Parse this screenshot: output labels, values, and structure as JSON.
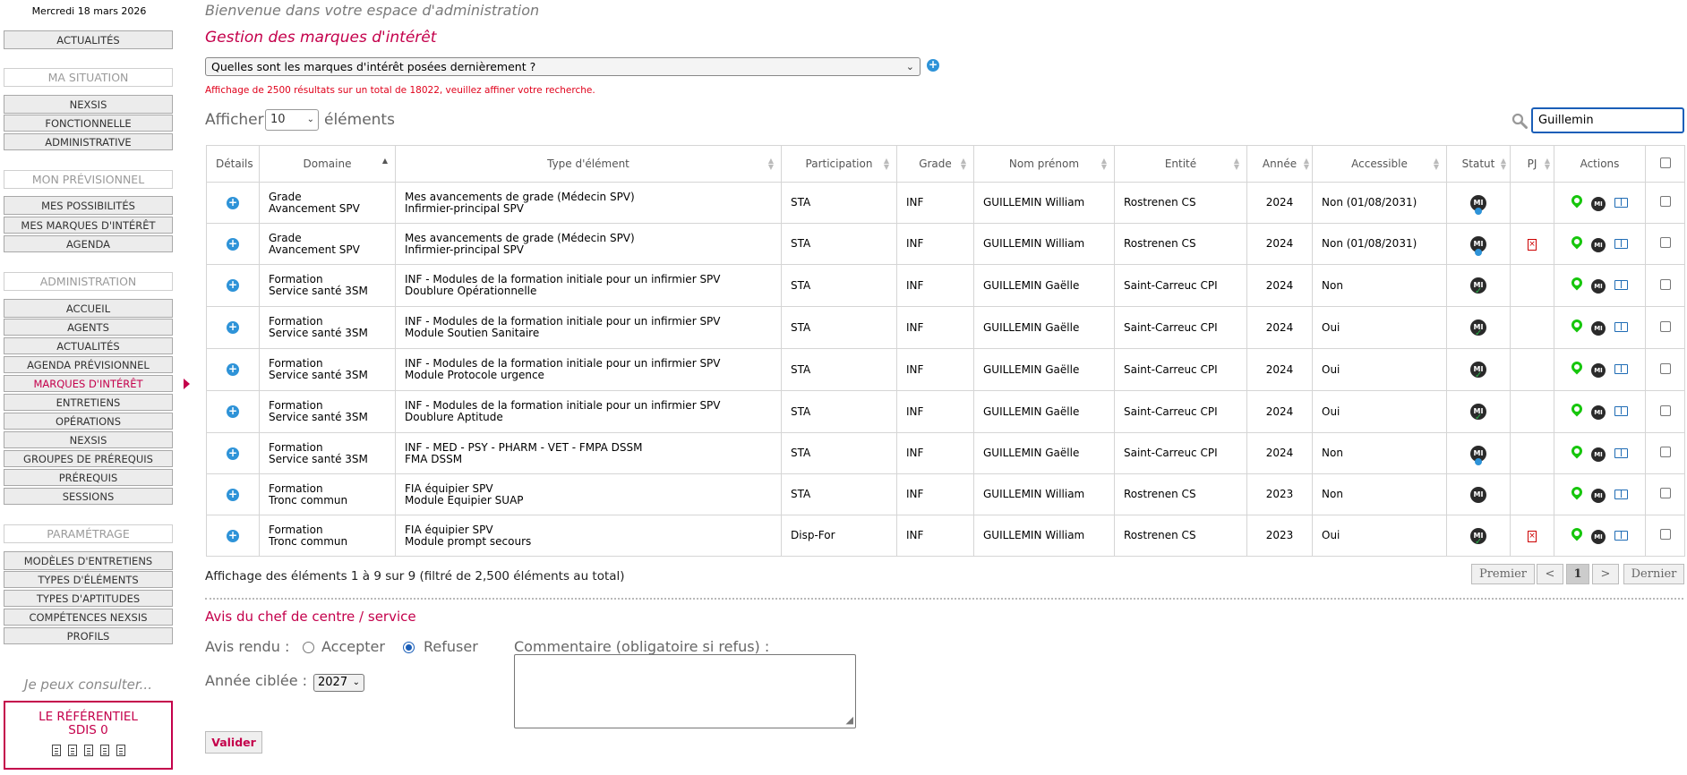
{
  "date": "Mercredi 18 mars 2026",
  "sidebar": {
    "actualites_top": "ACTUALITÉS",
    "sections": [
      {
        "head": "MA SITUATION",
        "items": [
          "NEXSIS",
          "FONCTIONNELLE",
          "ADMINISTRATIVE"
        ]
      },
      {
        "head": "MON PRÉVISIONNEL",
        "items": [
          "MES POSSIBILITÉS",
          "MES MARQUES D'INTÉRÊT",
          "AGENDA"
        ]
      },
      {
        "head": "ADMINISTRATION",
        "items": [
          "ACCUEIL",
          "AGENTS",
          "ACTUALITÉS",
          "AGENDA PRÉVISIONNEL",
          "MARQUES D'INTÉRÊT",
          "ENTRETIENS",
          "OPÉRATIONS",
          "NEXSIS",
          "GROUPES DE PRÉREQUIS",
          "PRÉREQUIS",
          "SESSIONS"
        ]
      },
      {
        "head": "PARAMÉTRAGE",
        "items": [
          "MODÈLES D'ENTRETIENS",
          "TYPES D'ÉLÉMENTS",
          "TYPES D'APTITUDES",
          "COMPÉTENCES NEXSIS",
          "PROFILS"
        ]
      }
    ],
    "active_item": "MARQUES D'INTÉRÊT",
    "consult_label": "Je peux consulter...",
    "referentiel_title": "LE RÉFÉRENTIEL",
    "referentiel_sub": "SDIS 0"
  },
  "main": {
    "welcome": "Bienvenue dans votre espace d'administration",
    "title": "Gestion des marques d'intérêt",
    "query_select": "Quelles sont les marques d'intérêt posées dernièrement ?",
    "warning": "Affichage de 2500 résultats sur un total de 18022, veuillez affiner votre recherche.",
    "length_prefix": "Afficher",
    "length_value": "10",
    "length_suffix": "éléments",
    "search_value": "Guillemin",
    "columns": [
      "Détails",
      "Domaine",
      "Type d'élément",
      "Participation",
      "Grade",
      "Nom prénom",
      "Entité",
      "Année",
      "Accessible",
      "Statut",
      "PJ",
      "Actions"
    ],
    "rows": [
      {
        "domaine1": "Grade",
        "domaine2": "Avancement SPV",
        "type1": "Mes avancements de grade (Médecin SPV)",
        "type2": "Infirmier-principal SPV",
        "participation": "STA",
        "grade": "INF",
        "nom": "GUILLEMIN William",
        "entite": "Rostrenen CS",
        "annee": "2024",
        "accessible": "Non (01/08/2031)",
        "statut": "blue",
        "pj": false
      },
      {
        "domaine1": "Grade",
        "domaine2": "Avancement SPV",
        "type1": "Mes avancements de grade (Médecin SPV)",
        "type2": "Infirmier-principal SPV",
        "participation": "STA",
        "grade": "INF",
        "nom": "GUILLEMIN William",
        "entite": "Rostrenen CS",
        "annee": "2024",
        "accessible": "Non (01/08/2031)",
        "statut": "blue",
        "pj": true
      },
      {
        "domaine1": "Formation",
        "domaine2": "Service santé 3SM",
        "type1": "INF - Modules de la formation initiale pour un infirmier SPV",
        "type2": "Doublure Opérationnelle",
        "participation": "STA",
        "grade": "INF",
        "nom": "GUILLEMIN Gaëlle",
        "entite": "Saint-Carreuc CPI",
        "annee": "2024",
        "accessible": "Non",
        "statut": "green",
        "pj": false
      },
      {
        "domaine1": "Formation",
        "domaine2": "Service santé 3SM",
        "type1": "INF - Modules de la formation initiale pour un infirmier SPV",
        "type2": "Module Soutien Sanitaire",
        "participation": "STA",
        "grade": "INF",
        "nom": "GUILLEMIN Gaëlle",
        "entite": "Saint-Carreuc CPI",
        "annee": "2024",
        "accessible": "Oui",
        "statut": "green",
        "pj": false
      },
      {
        "domaine1": "Formation",
        "domaine2": "Service santé 3SM",
        "type1": "INF - Modules de la formation initiale pour un infirmier SPV",
        "type2": "Module Protocole urgence",
        "participation": "STA",
        "grade": "INF",
        "nom": "GUILLEMIN Gaëlle",
        "entite": "Saint-Carreuc CPI",
        "annee": "2024",
        "accessible": "Oui",
        "statut": "green",
        "pj": false
      },
      {
        "domaine1": "Formation",
        "domaine2": "Service santé 3SM",
        "type1": "INF - Modules de la formation initiale pour un infirmier SPV",
        "type2": "Doublure Aptitude",
        "participation": "STA",
        "grade": "INF",
        "nom": "GUILLEMIN Gaëlle",
        "entite": "Saint-Carreuc CPI",
        "annee": "2024",
        "accessible": "Oui",
        "statut": "green",
        "pj": false
      },
      {
        "domaine1": "Formation",
        "domaine2": "Service santé 3SM",
        "type1": "INF - MED - PSY - PHARM - VET - FMPA DSSM",
        "type2": "FMA DSSM",
        "participation": "STA",
        "grade": "INF",
        "nom": "GUILLEMIN Gaëlle",
        "entite": "Saint-Carreuc CPI",
        "annee": "2024",
        "accessible": "Non",
        "statut": "blue",
        "pj": false
      },
      {
        "domaine1": "Formation",
        "domaine2": "Tronc commun",
        "type1": "FIA équipier SPV",
        "type2": "Module Equipier SUAP",
        "participation": "STA",
        "grade": "INF",
        "nom": "GUILLEMIN William",
        "entite": "Rostrenen CS",
        "annee": "2023",
        "accessible": "Non",
        "statut": "plain",
        "pj": false
      },
      {
        "domaine1": "Formation",
        "domaine2": "Tronc commun",
        "type1": "FIA équipier SPV",
        "type2": "Module prompt secours",
        "participation": "Disp-For",
        "grade": "INF",
        "nom": "GUILLEMIN William",
        "entite": "Rostrenen CS",
        "annee": "2023",
        "accessible": "Oui",
        "statut": "green",
        "pj": true
      }
    ],
    "info": "Affichage des éléments 1 à 9 sur 9 (filtré de 2,500 éléments au total)",
    "pager": {
      "first": "Premier",
      "prev": "<",
      "current": "1",
      "next": ">",
      "last": "Dernier"
    },
    "avis_title": "Avis du chef de centre / service",
    "avis_label": "Avis rendu :",
    "accepter": "Accepter",
    "refuser": "Refuser",
    "avis_selected": "Refuser",
    "annee_label": "Année ciblée :",
    "annee_value": "2027",
    "commentaire_label": "Commentaire (obligatoire si refus) :",
    "valider": "Valider"
  },
  "colors": {
    "accent": "#c4004b",
    "blue": "#2e93d8",
    "green": "#16c60c"
  },
  "icons": {
    "details": "plus-circle-icon",
    "statut": "mi-badge-icon",
    "pj": "file-error-icon",
    "actions": [
      "map-pin-icon",
      "mi-icon",
      "book-icon"
    ]
  }
}
